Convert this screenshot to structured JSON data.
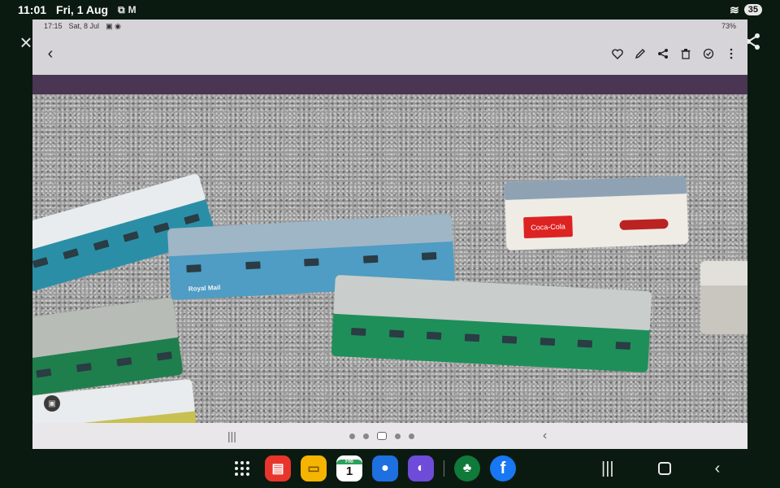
{
  "outer_status": {
    "time": "11:01",
    "date": "Fri, 1 Aug",
    "battery": "35"
  },
  "inner_status": {
    "time": "17:15",
    "date": "Sat, 8 Jul",
    "battery": "73%"
  },
  "toolbar": {
    "icons": [
      "back-icon",
      "heart-icon",
      "edit-icon",
      "share-icon",
      "trash-icon",
      "remaster-icon",
      "more-icon"
    ]
  },
  "photo": {
    "signs": {
      "coke": "Coca-Cola",
      "royal_mail": "Royal Mail"
    }
  },
  "pager": {
    "count": 5,
    "active_index": 2
  },
  "taskbar": {
    "calendar_day": "FRI",
    "calendar_date": "1",
    "apps": [
      "app-drawer",
      "samsung-notes",
      "my-files",
      "calendar",
      "messages",
      "safety-app",
      "smartthings",
      "facebook"
    ]
  },
  "colors": {
    "background": "#0b1a10",
    "purple": "#4a3552",
    "facebook": "#1877f2"
  }
}
